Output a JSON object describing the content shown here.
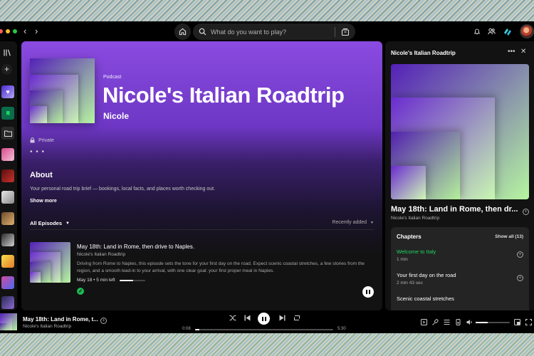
{
  "search": {
    "placeholder": "What do you want to play?"
  },
  "podcast": {
    "type_label": "Podcast",
    "title": "Nicole's Italian Roadtrip",
    "author": "Nicole",
    "visibility": "Private",
    "about_heading": "About",
    "about_text": "Your personal road trip brief — bookings, local facts, and places worth checking out.",
    "show_more": "Show more"
  },
  "episodes": {
    "filter_label": "All Episodes",
    "sort_label": "Recently added",
    "items": [
      {
        "title": "May 18th: Land in Rome, then drive to Naples.",
        "show": "Nicole's Italian Roadtrip",
        "description": "Driving from Rome to Naples, this episode sets the tone for your first day on the road. Expect scenic coastal stretches, a few stories from the region, and a smooth lead-in to your arrival, with one clear goal: your first proper meal in Naples.",
        "meta": "May 18 • 5 min left",
        "progress": 0.55
      }
    ]
  },
  "right_panel": {
    "title": "Nicole's Italian Roadtrip",
    "episode_title": "May 18th: Land in Rome, then dr...",
    "show": "Nicole's Italian Roadtrip",
    "chapters_heading": "Chapters",
    "show_all": "Show all (13)",
    "chapters": [
      {
        "title": "Welcome to Italy",
        "duration": "1 min",
        "active": true
      },
      {
        "title": "Your first day on the road",
        "duration": "2 min 43 sec",
        "active": false
      },
      {
        "title": "Scenic coastal stretches",
        "duration": "",
        "active": false
      }
    ]
  },
  "player": {
    "title": "May 18th: Land in Rome, t...",
    "show": "Nicole's Italian Roadtrip",
    "elapsed": "0:08",
    "total": "5:30",
    "progress": 0.03,
    "volume": 0.35
  },
  "colors": {
    "accent_green": "#1db954",
    "hero_purple": "#8a4be0",
    "art_green": "#b6f5a0"
  }
}
